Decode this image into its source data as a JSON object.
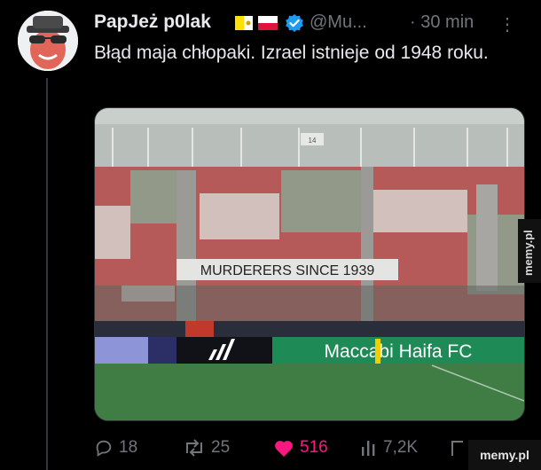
{
  "author": {
    "display_name": "PapJeż p0lak",
    "handle": "@Mu...",
    "separator": "·",
    "time": "30 min",
    "verified": true
  },
  "tweet": {
    "text": "Błąd maja chłopaki. Izrael istnieje od 1948 roku."
  },
  "media": {
    "banner_text": "MURDERERS SINCE 1939",
    "ad_board_text": "Maccabi Haifa FC",
    "section_number": "14"
  },
  "actions": {
    "replies": "18",
    "retweets": "25",
    "likes": "516",
    "views": "7,2K"
  },
  "watermark": {
    "side": "memy.pl",
    "bottom": "memy.pl"
  },
  "colors": {
    "background": "#000000",
    "text": "#e7e9ea",
    "secondary": "#71767b",
    "like": "#f91880",
    "verified": "#1d9bf0"
  },
  "icons": [
    "more-icon",
    "verified-icon",
    "reply-icon",
    "retweet-icon",
    "like-icon",
    "views-icon",
    "share-icon",
    "vatican-flag-icon",
    "poland-flag-icon"
  ]
}
